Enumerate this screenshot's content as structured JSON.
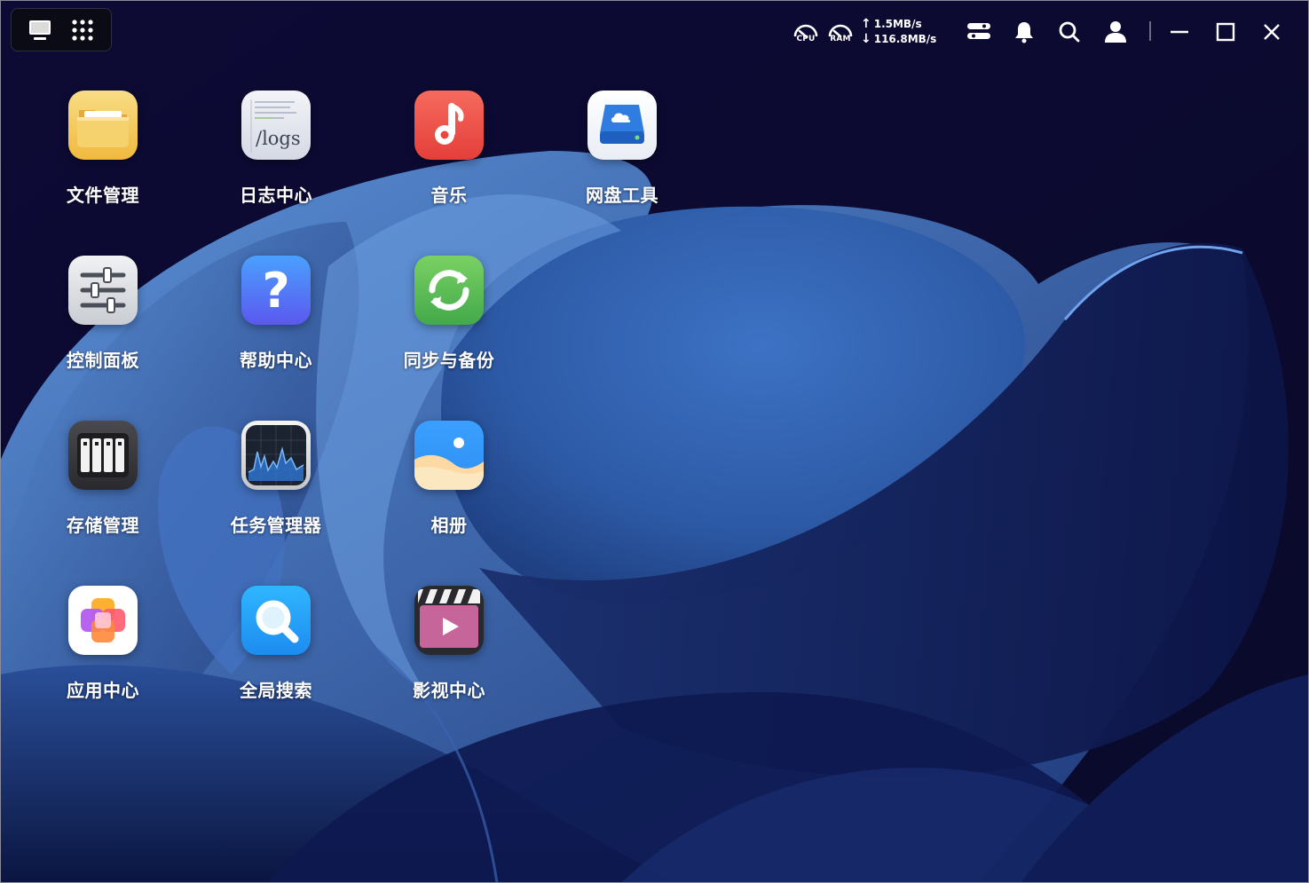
{
  "launcher": {
    "desktop_icon": "monitor-icon",
    "apps_icon": "grid-dots-icon"
  },
  "status": {
    "cpu_label": "CPU",
    "ram_label": "RAM",
    "upload_speed": "1.5MB/s",
    "download_speed": "116.8MB/s",
    "upload_arrow": "↑",
    "download_arrow": "↓"
  },
  "apps": [
    {
      "label": "文件管理",
      "icon": "folder-icon"
    },
    {
      "label": "日志中心",
      "icon": "logs-icon",
      "tile_text": "/logs"
    },
    {
      "label": "音乐",
      "icon": "music-note-icon"
    },
    {
      "label": "网盘工具",
      "icon": "cloud-drive-icon"
    },
    {
      "label": "控制面板",
      "icon": "sliders-icon"
    },
    {
      "label": "帮助中心",
      "icon": "question-icon",
      "tile_text": "?"
    },
    {
      "label": "同步与备份",
      "icon": "sync-icon"
    },
    {
      "label": "存储管理",
      "icon": "storage-bays-icon"
    },
    {
      "label": "任务管理器",
      "icon": "activity-chart-icon"
    },
    {
      "label": "相册",
      "icon": "photo-landscape-icon"
    },
    {
      "label": "应用中心",
      "icon": "app-blocks-icon"
    },
    {
      "label": "全局搜索",
      "icon": "magnifier-icon"
    },
    {
      "label": "影视中心",
      "icon": "clapperboard-play-icon"
    }
  ],
  "colors": {
    "background": "#0d0a35",
    "wallpaper_blue": "#2d5aa6"
  }
}
